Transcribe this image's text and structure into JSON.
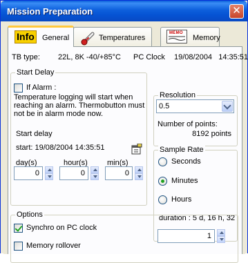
{
  "window": {
    "title": "Mission Preparation",
    "close_glyph": "✕"
  },
  "tabs": [
    {
      "label": "General",
      "icon": "info-icon",
      "icon_text": "Info",
      "active": true
    },
    {
      "label": "Temperatures",
      "icon": "thermometer-icon",
      "active": false
    },
    {
      "label": "Memory",
      "icon": "memo-icon",
      "icon_text": "MEMO",
      "active": false
    }
  ],
  "info": {
    "tb_type_label": "TB type:",
    "tb_type_value": "22L, 8K -40/+85°C",
    "clock_label": "PC Clock",
    "clock_value": "19/08/2004   14:35:51"
  },
  "start_delay": {
    "title": "Start Delay",
    "if_alarm_label": "If Alarm :",
    "if_alarm_checked": false,
    "description_lines": [
      "Temperature logging will start when",
      "reaching an alarm. Thermobutton must",
      "not be in alarm mode now."
    ],
    "start_delay_label": "Start delay",
    "start_value": "start: 19/08/2004 14:35:51",
    "fields": [
      {
        "label": "day(s)",
        "value": "0"
      },
      {
        "label": "hour(s)",
        "value": "0"
      },
      {
        "label": "min(s)",
        "value": "0"
      }
    ]
  },
  "resolution": {
    "title": "Resolution",
    "selected": "0.5",
    "points_label": "Number of points:",
    "points_value": "8192 points"
  },
  "sample_rate": {
    "title": "Sample Rate",
    "options": [
      {
        "label": "Seconds",
        "checked": false
      },
      {
        "label": "Minutes",
        "checked": true
      },
      {
        "label": "Hours",
        "checked": false
      }
    ],
    "duration": "duration : 5 d, 16 h, 32",
    "value": "1"
  },
  "options": {
    "title": "Options",
    "items": [
      {
        "label": "Synchro on PC clock",
        "checked": true
      },
      {
        "label": "Memory rollover",
        "checked": false
      }
    ]
  }
}
